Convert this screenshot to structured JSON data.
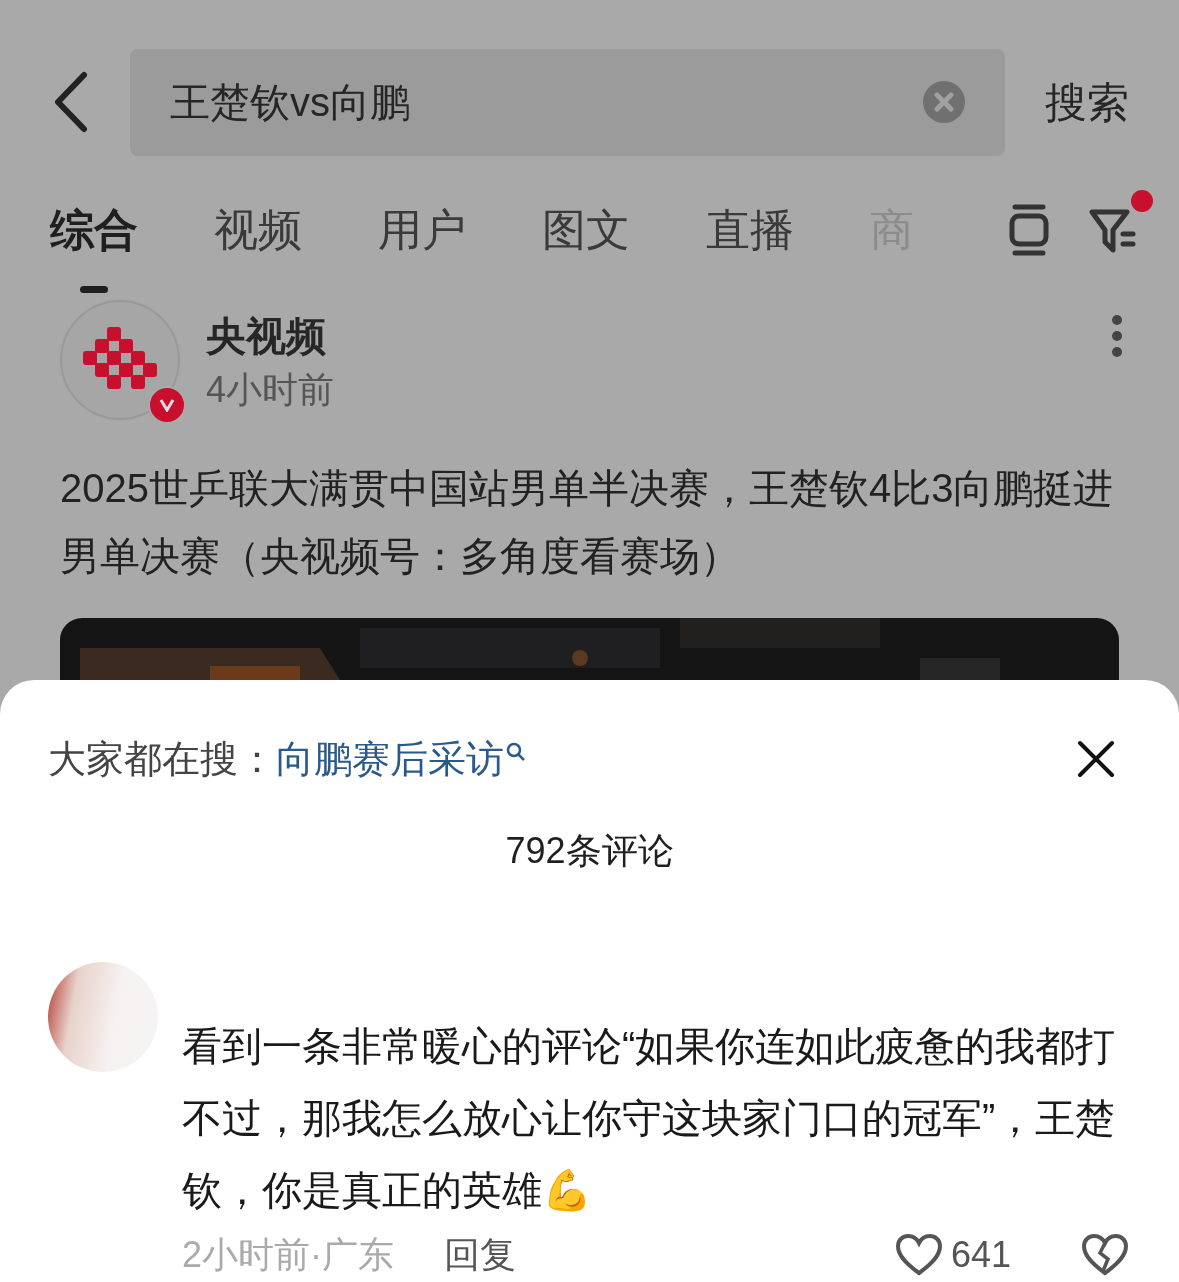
{
  "search_bar": {
    "value": "王楚钦vs向鹏",
    "submit": "搜索"
  },
  "tabs": [
    {
      "label": "综合",
      "selected": true
    },
    {
      "label": "视频",
      "selected": false
    },
    {
      "label": "用户",
      "selected": false
    },
    {
      "label": "图文",
      "selected": false
    },
    {
      "label": "直播",
      "selected": false
    },
    {
      "label": "商",
      "selected": false
    }
  ],
  "filter": {
    "has_notification": true
  },
  "post": {
    "author": "央视频",
    "verified": true,
    "time": "4小时前",
    "title": "2025世乒联大满贯中国站男单半决赛，王楚钦4比3向鹏挺进男单决赛（央视频号：多角度看赛场）"
  },
  "comments_sheet": {
    "trending_label": "大家都在搜：",
    "trending_query": "向鹏赛后采访",
    "count": "792条评论",
    "comments": [
      {
        "text": "看到一条非常暖心的评论“如果你连如此疲惫的我都打不过，那我怎么放心让你守这块家门口的冠军”，王楚钦，你是真正的英雄💪",
        "time_location": "2小时前·广东",
        "reply": "回复",
        "likes": "641",
        "liked": false
      }
    ]
  }
}
